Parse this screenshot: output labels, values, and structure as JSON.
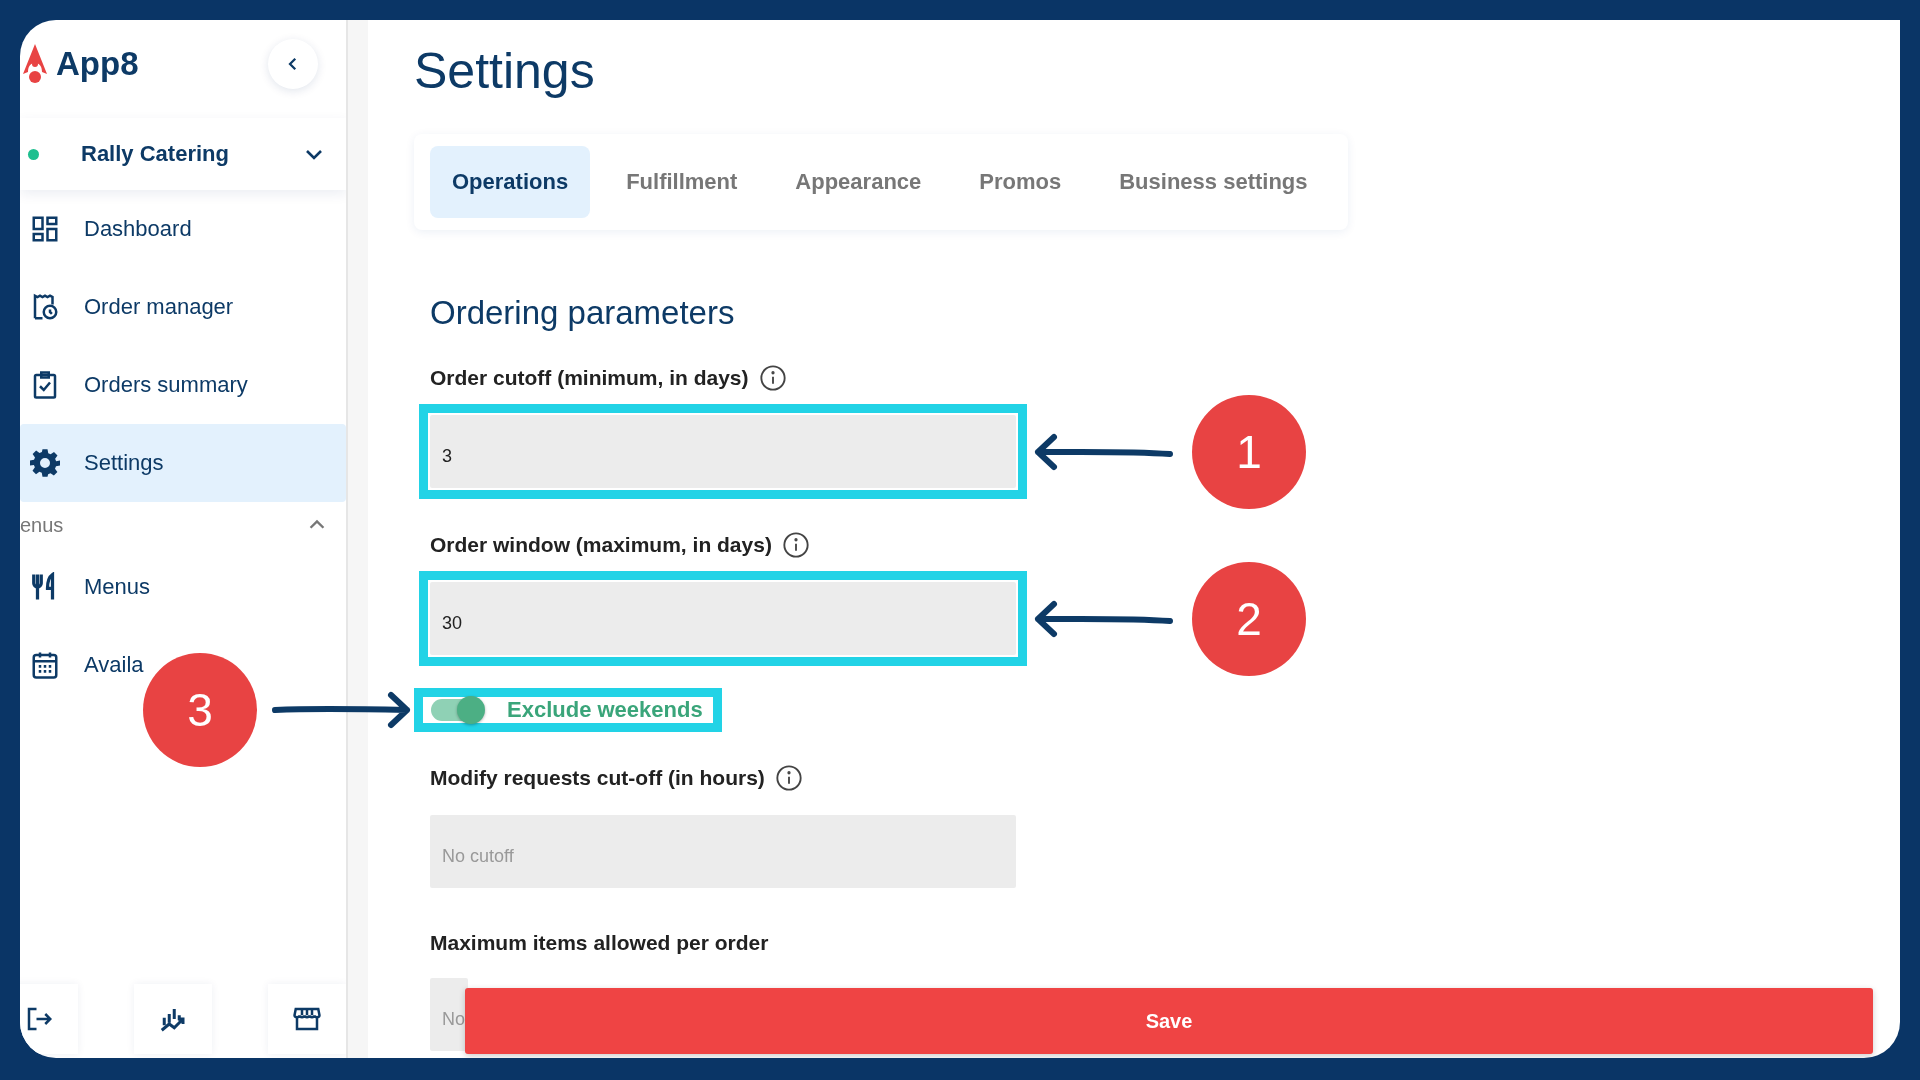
{
  "brand": {
    "name": "App8"
  },
  "location": {
    "name": "Rally Catering",
    "online": true
  },
  "nav": [
    {
      "kind": "dashboard",
      "label": "Dashboard",
      "selected": false
    },
    {
      "kind": "orders",
      "label": "Order manager",
      "selected": false
    },
    {
      "kind": "summary",
      "label": "Orders summary",
      "selected": false
    },
    {
      "kind": "settings",
      "label": "Settings",
      "selected": true
    }
  ],
  "menu_section": {
    "label": "enus",
    "expanded": true,
    "items": [
      {
        "kind": "menus",
        "label": "Menus",
        "selected": false
      },
      {
        "kind": "calendar",
        "label": "Availa",
        "selected": false
      }
    ]
  },
  "footer_buttons": [
    {
      "kind": "logout"
    },
    {
      "kind": "analytics"
    },
    {
      "kind": "store"
    }
  ],
  "page_title": "Settings",
  "tabs": [
    {
      "label": "Operations",
      "selected": true
    },
    {
      "label": "Fulfillment",
      "selected": false
    },
    {
      "label": "Appearance",
      "selected": false
    },
    {
      "label": "Promos",
      "selected": false
    },
    {
      "label": "Business settings",
      "selected": false
    }
  ],
  "section_title": "Ordering parameters",
  "fields": [
    {
      "kind": "input",
      "label": "Order cutoff (minimum, in days)",
      "info": true,
      "value": "3",
      "highlighted": true,
      "marker": "1"
    },
    {
      "kind": "input",
      "label": "Order window (maximum, in days)",
      "info": true,
      "value": "30",
      "highlighted": true,
      "marker": "2"
    },
    {
      "kind": "toggle",
      "label": "Exclude weekends",
      "on": true,
      "highlighted": true,
      "marker": "3"
    },
    {
      "kind": "input",
      "label": "Modify requests cut-off (in hours)",
      "info": true,
      "placeholder": "No cutoff",
      "highlighted": false
    },
    {
      "kind": "input",
      "label": "Maximum items allowed per order",
      "info": false,
      "placeholder": "No",
      "highlighted": false
    }
  ],
  "save_button": "Save"
}
